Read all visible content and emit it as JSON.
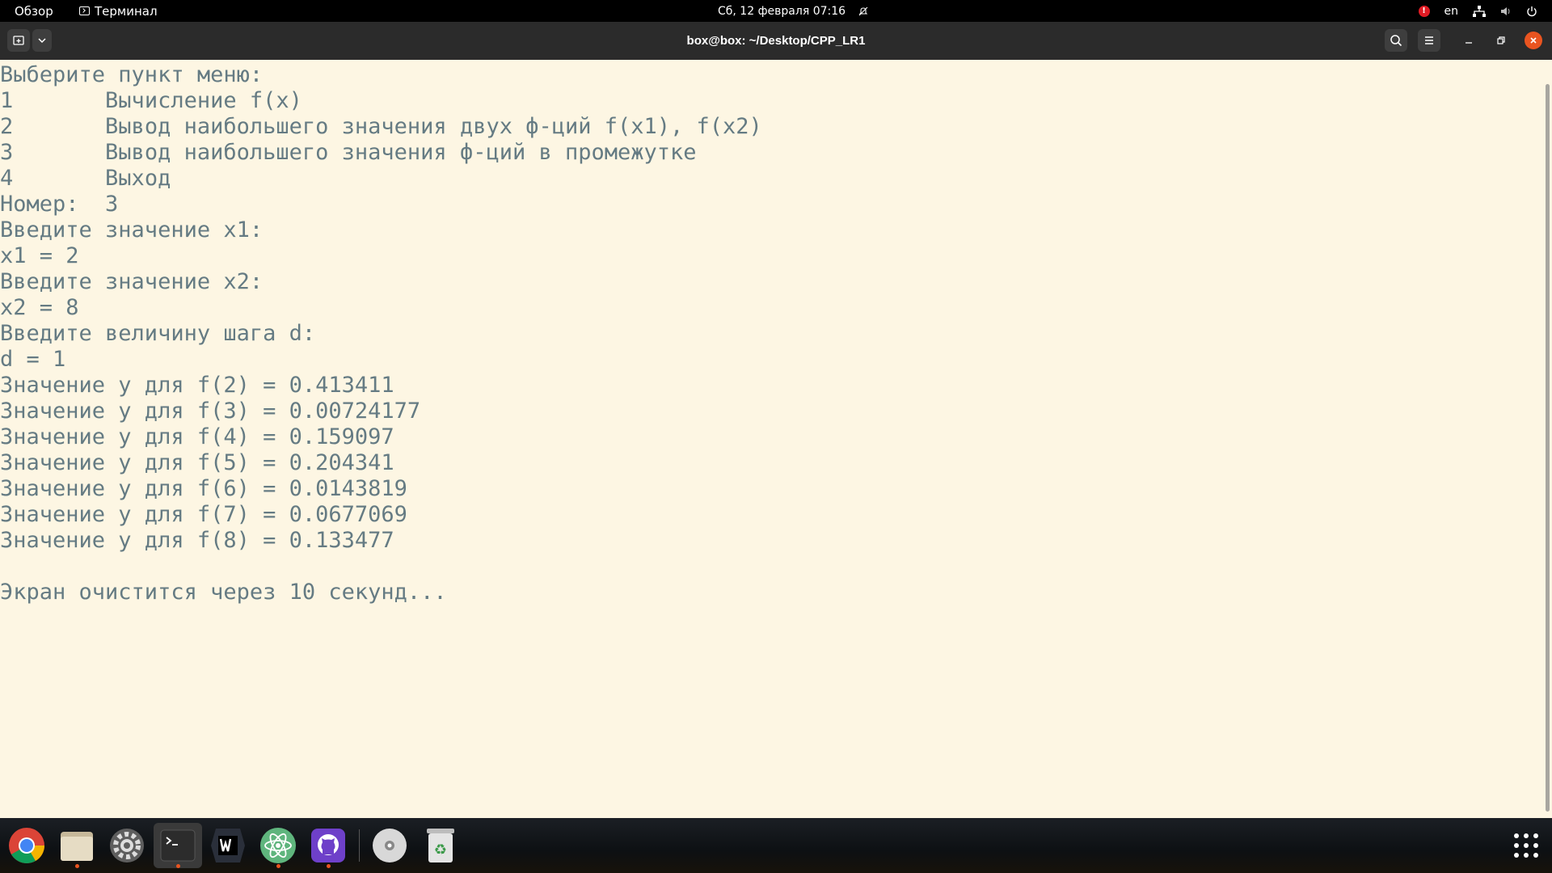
{
  "topbar": {
    "activities": "Обзор",
    "app_name": "Терминал",
    "clock": "Сб, 12 февраля  07:16",
    "keyboard_layout": "en",
    "notification_badge": "!"
  },
  "window": {
    "title": "box@box: ~/Desktop/CPP_LR1"
  },
  "terminal": {
    "lines": [
      "Выберите пункт меню:",
      "1\tВычисление f(x)",
      "2\tВывод наибольшего значения двух ф-ций f(x1), f(x2)",
      "3\tВывод наибольшего значения ф-ций в промежутке",
      "4\tВыход",
      "Номер:  3",
      "Введите значение x1:",
      "x1 = 2",
      "Введите значение x2:",
      "x2 = 8",
      "Введите величину шага d:",
      "d = 1",
      "Значение y для f(2) = 0.413411",
      "Значение y для f(3) = 0.00724177",
      "Значение y для f(4) = 0.159097",
      "Значение y для f(5) = 0.204341",
      "Значение y для f(6) = 0.0143819",
      "Значение y для f(7) = 0.0677069",
      "Значение y для f(8) = 0.133477",
      "",
      "Экран очистится через 10 секунд..."
    ]
  },
  "colors": {
    "terminal_bg": "#fdf6e3",
    "terminal_fg": "#657b83",
    "accent": "#e95420",
    "headerbar": "#2b2b2b"
  },
  "dock": {
    "items": [
      {
        "name": "chrome-icon",
        "running": false
      },
      {
        "name": "files-icon",
        "running": true
      },
      {
        "name": "settings-icon",
        "running": false
      },
      {
        "name": "terminal-icon",
        "running": true
      },
      {
        "name": "webstorm-icon",
        "running": false
      },
      {
        "name": "atom-icon",
        "running": true
      },
      {
        "name": "github-desktop-icon",
        "running": true
      },
      {
        "name": "disc-icon",
        "running": false
      },
      {
        "name": "trash-icon",
        "running": false
      },
      {
        "name": "show-apps-icon",
        "running": false
      }
    ]
  }
}
